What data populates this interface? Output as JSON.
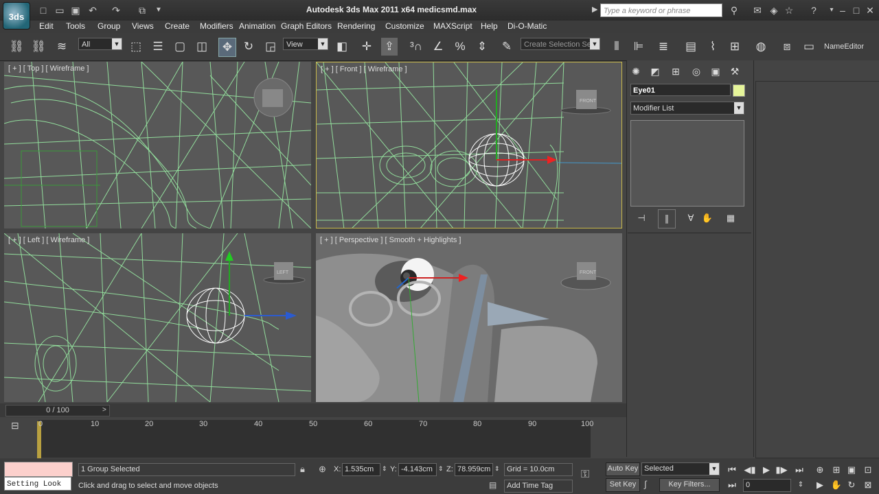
{
  "app": {
    "title": "Autodesk 3ds Max  2011 x64     medicsmd.max",
    "logo": "3ds",
    "search_placeholder": "Type a keyword or phrase"
  },
  "menu": [
    "Edit",
    "Tools",
    "Group",
    "Views",
    "Create",
    "Modifiers",
    "Animation",
    "Graph Editors",
    "Rendering",
    "Customize",
    "MAXScript",
    "Help",
    "Di-O-Matic"
  ],
  "toolbar": {
    "selection_filter": "All",
    "coord_system": "View",
    "named_selection_placeholder": "Create Selection Se",
    "name_editor": "NameEditor"
  },
  "viewports": {
    "top_left": {
      "label": "[ + ] [ Top ] [ Wireframe ]"
    },
    "front": {
      "label": "[ + ] [ Front ] [ Wireframe ]",
      "cube": "FRONT"
    },
    "left": {
      "label": "[ + ] [ Left ] [ Wireframe ]",
      "cube": "LEFT"
    },
    "perspective": {
      "label": "[ + ] [ Perspective ] [ Smooth + Highlights ]",
      "cube": "FRONT"
    }
  },
  "command_panel": {
    "object_name": "Eye01",
    "object_color": "#e6f59a",
    "modifier_list": "Modifier List"
  },
  "timeline": {
    "slider": "0 / 100",
    "ticks": [
      "0",
      "10",
      "20",
      "30",
      "40",
      "50",
      "60",
      "70",
      "80",
      "90",
      "100"
    ]
  },
  "status": {
    "selection": "1 Group Selected",
    "prompt": "Click and drag to select and move objects",
    "maxscript": "Setting Look",
    "x_label": "X:",
    "x": "1.535cm",
    "y_label": "Y:",
    "y": "-4.143cm",
    "z_label": "Z:",
    "z": "78.959cm",
    "grid": "Grid = 10.0cm",
    "add_time_tag": "Add Time Tag",
    "auto_key": "Auto Key",
    "set_key": "Set Key",
    "key_mode": "Selected",
    "key_filters": "Key Filters...",
    "current_frame": "0"
  }
}
